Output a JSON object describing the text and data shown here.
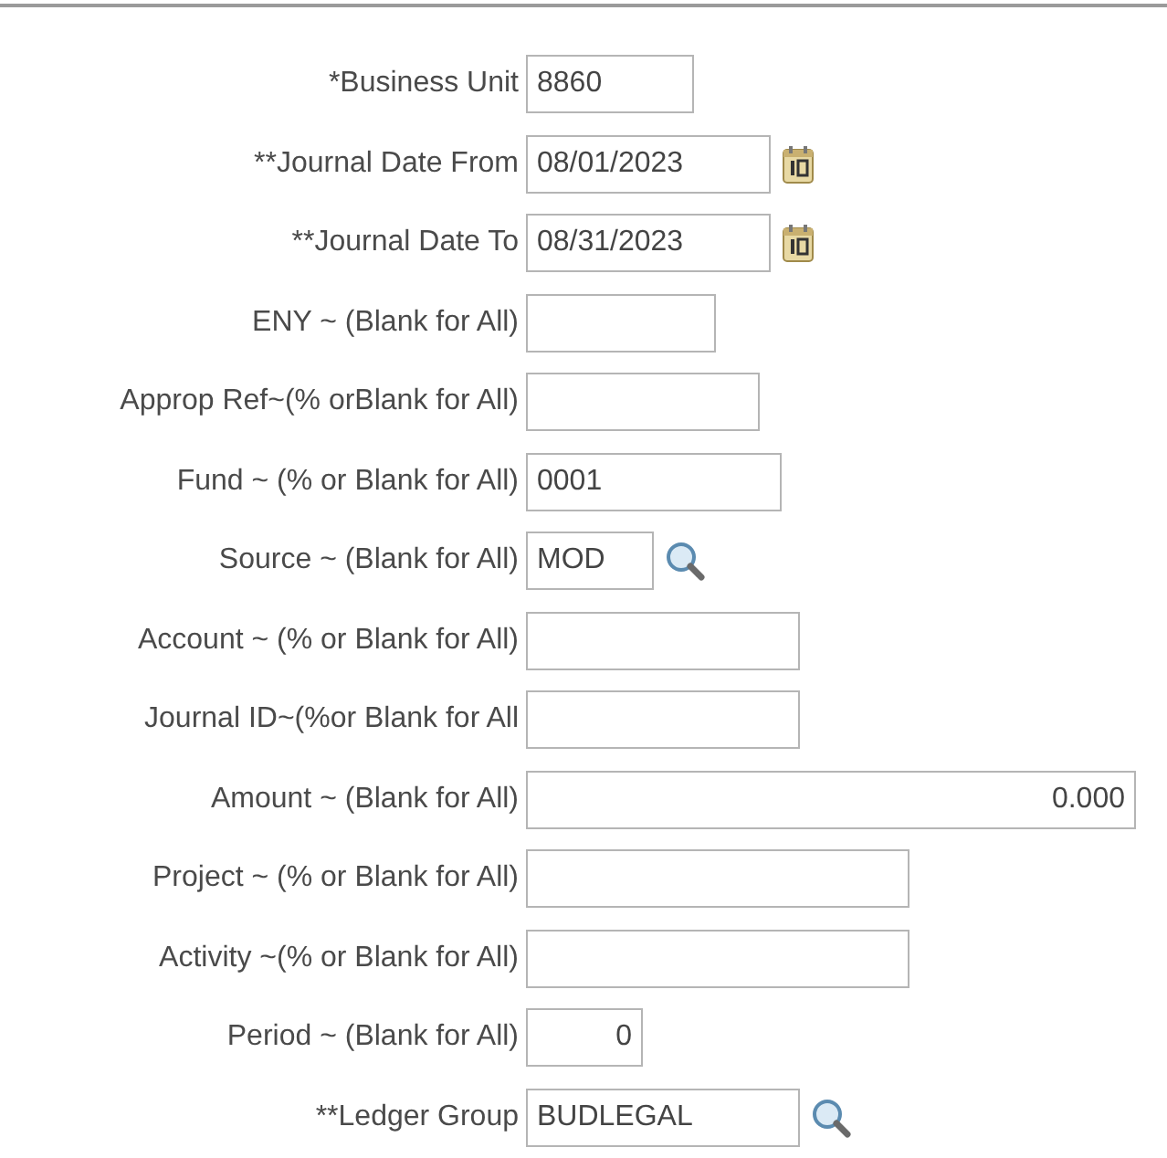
{
  "fields": [
    {
      "label": "*Business Unit",
      "value": "8860",
      "kind": "text"
    },
    {
      "label": "**Journal Date From",
      "value": "08/01/2023",
      "kind": "date"
    },
    {
      "label": "**Journal Date To",
      "value": "08/31/2023",
      "kind": "date"
    },
    {
      "label": "ENY ~ (Blank for All)",
      "kind": "text"
    },
    {
      "label": "Approp Ref~(% orBlank for All)",
      "kind": "text"
    },
    {
      "label": "Fund ~ (% or Blank for All)",
      "value": "0001",
      "kind": "text"
    },
    {
      "label": "Source ~ (Blank for All)",
      "value": "MOD",
      "kind": "lookup"
    },
    {
      "label": "Account ~ (% or Blank for All)",
      "kind": "text"
    },
    {
      "label": "Journal ID~(%or Blank for All",
      "kind": "text"
    },
    {
      "label": "Amount ~ (Blank for All)",
      "value": "0.000",
      "kind": "number"
    },
    {
      "label": "Project ~ (% or Blank for All)",
      "kind": "text"
    },
    {
      "label": "Activity ~(% or Blank for All)",
      "kind": "text"
    },
    {
      "label": "Period ~ (Blank for All)",
      "value": "0",
      "kind": "number"
    },
    {
      "label": "**Ledger Group",
      "value": "BUDLEGAL",
      "kind": "lookup"
    }
  ]
}
